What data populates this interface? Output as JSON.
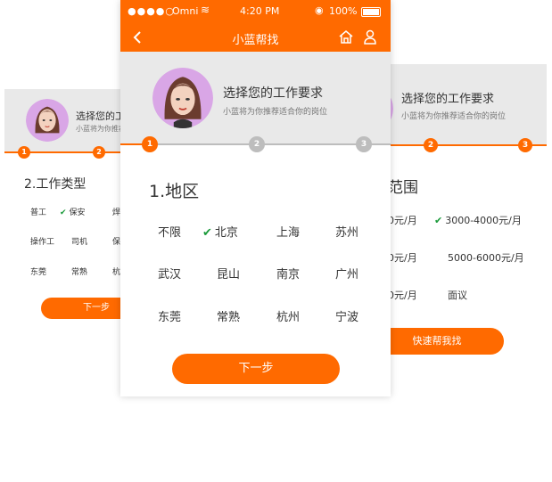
{
  "colors": {
    "accent": "#ff6a00",
    "header_bg": "#e9e9e9",
    "check": "#1a9a3a",
    "step_inactive": "#bdbdbd"
  },
  "header": {
    "title": "选择您的工作要求",
    "subtitle": "小蓝将为你推荐适合你的岗位"
  },
  "status_bar": {
    "carrier": "Omni",
    "time": "4:20 PM",
    "battery": "100%"
  },
  "nav": {
    "title": "小蓝帮找",
    "back_icon": "chevron-left-icon",
    "home_icon": "home-icon",
    "user_icon": "user-icon"
  },
  "left_screen": {
    "steps": [
      "1",
      "2"
    ],
    "section_title": "2.工作类型",
    "options": [
      "普工",
      "保安",
      "焊",
      "操作工",
      "司机",
      "保",
      "东莞",
      "常熟",
      "杭"
    ],
    "selected": "保安",
    "button": "下一步"
  },
  "center_screen": {
    "steps": [
      "1",
      "2",
      "3"
    ],
    "section_title": "1.地区",
    "options": [
      "不限",
      "北京",
      "上海",
      "苏州",
      "武汉",
      "昆山",
      "南京",
      "广州",
      "东莞",
      "常熟",
      "杭州",
      "宁波"
    ],
    "selected": "北京",
    "button": "下一步"
  },
  "right_screen": {
    "steps": [
      "2",
      "3"
    ],
    "section_title": "范围",
    "options": [
      "0元/月",
      "3000-4000元/月",
      "0元/月",
      "5000-6000元/月",
      "0元/月",
      "面议"
    ],
    "selected": "3000-4000元/月",
    "button": "快速帮我找"
  }
}
